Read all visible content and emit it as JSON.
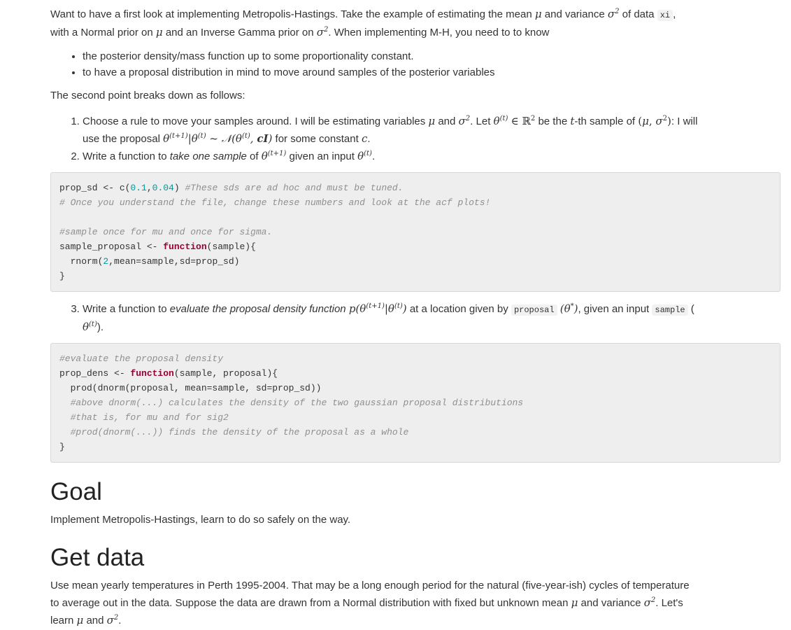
{
  "intro": {
    "l1a": "Want to have a first look at implementing Metropolis-Hastings. Take the example of estimating the mean",
    "l1b": "and variance",
    "l1c": "of data",
    "l1_code": "xi",
    "l1d": ",",
    "l2a": "with a Normal prior on",
    "l2b": "and an Inverse Gamma prior on",
    "l2c": ". When implementing M-H, you need to to know"
  },
  "bullets": [
    "the posterior density/mass function up to some proportionality constant.",
    "to have a proposal distribution in mind to move around samples of the posterior variables"
  ],
  "second_point": "The second point breaks down as follows:",
  "steps": {
    "s1a": "Choose a rule to move your samples around. I will be estimating variables",
    "s1b": "and",
    "s1c": ". Let",
    "s1d": "be the",
    "s1e": "-th sample of",
    "s1f": ": I will",
    "s1g": "use the proposal",
    "s1h": "for some constant",
    "s2a": "Write a function to",
    "s2em": "take one sample",
    "s2b": "of",
    "s2c": "given an input",
    "s3a": "Write a function to",
    "s3em": "evaluate the proposal density function",
    "s3b": "at a location given by",
    "s3_code1": "proposal",
    "s3c": ", given an input",
    "s3_code2": "sample",
    "s3d": "("
  },
  "code1": {
    "l1_a": "prop_sd <- c(",
    "l1_n1": "0.1",
    "l1_b": ",",
    "l1_n2": "0.04",
    "l1_c": ") ",
    "l1_cm": "#These sds are ad hoc and must be tuned.",
    "l2_cm": "# Once you understand the file, change these numbers and look at the acf plots!",
    "l4_cm": "#sample once for mu and once for sigma.",
    "l5_a": "sample_proposal <- ",
    "l5_kw": "function",
    "l5_b": "(sample){",
    "l6_a": "  rnorm(",
    "l6_n": "2",
    "l6_b": ",mean=sample,sd=prop_sd)",
    "l7": "}"
  },
  "code2": {
    "l1_cm": "#evaluate the proposal density",
    "l2_a": "prop_dens <- ",
    "l2_kw": "function",
    "l2_b": "(sample, proposal){",
    "l3": "  prod(dnorm(proposal, mean=sample, sd=prop_sd))",
    "l4_cm": "  #above dnorm(...) calculates the density of the two gaussian proposal distributions",
    "l5_cm": "  #that is, for mu and for sig2",
    "l6_cm": "  #prod(dnorm(...)) finds the density of the proposal as a whole",
    "l7": "}"
  },
  "goal": {
    "heading": "Goal",
    "text": "Implement Metropolis-Hastings, learn to do so safely on the way."
  },
  "getdata": {
    "heading": "Get data",
    "l1": "Use mean yearly temperatures in Perth 1995-2004. That may be a long enough period for the natural (five-year-ish) cycles of temperature",
    "l2a": "to average out in the data. Suppose the data are drawn from a Normal distribution with fixed but unknown mean",
    "l2b": "and variance",
    "l2c": ". Let's",
    "l3a": "learn",
    "l3b": "and",
    "l3c": "."
  }
}
